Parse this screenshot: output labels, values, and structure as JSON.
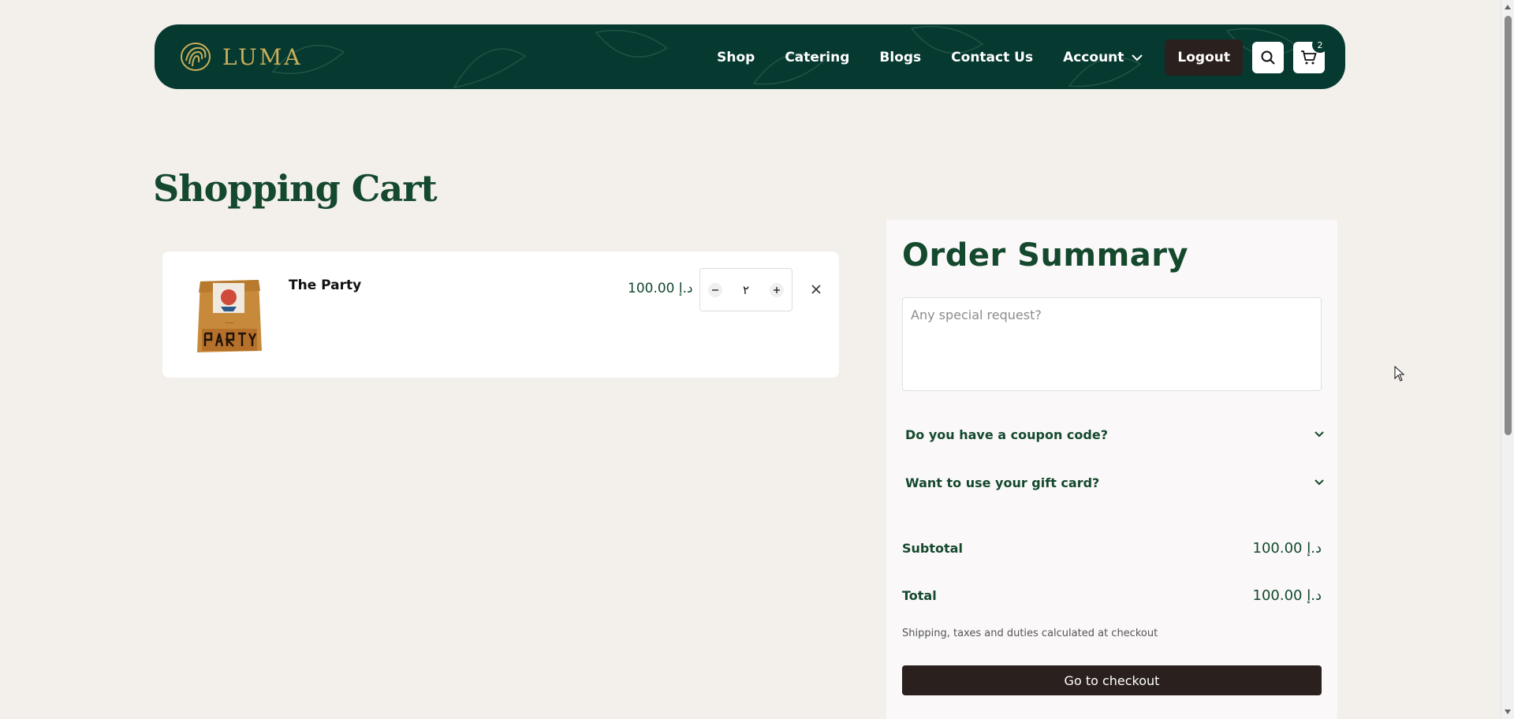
{
  "header": {
    "brand": "LUMA",
    "nav": {
      "shop": "Shop",
      "catering": "Catering",
      "blogs": "Blogs",
      "contact": "Contact Us",
      "account": "Account"
    },
    "logout": "Logout",
    "cart_count": "2"
  },
  "page": {
    "title": "Shopping Cart"
  },
  "cart": {
    "items": [
      {
        "name": "The Party",
        "price": "100.00 د.إ",
        "quantity": "٢"
      }
    ]
  },
  "summary": {
    "title": "Order Summary",
    "request_placeholder": "Any special request?",
    "coupon_label": "Do you have a coupon code?",
    "gift_label": "Want to use your gift card?",
    "subtotal_label": "Subtotal",
    "subtotal_value": "100.00 د.إ",
    "total_label": "Total",
    "total_value": "100.00 د.إ",
    "shipping_note": "Shipping, taxes and duties calculated at checkout",
    "checkout": "Go to checkout"
  },
  "colors": {
    "header_bg": "#063a30",
    "brand_gold": "#c9ae5a",
    "accent_green": "#14492e",
    "dark_button": "#2a211e",
    "page_bg": "#f3efea"
  }
}
